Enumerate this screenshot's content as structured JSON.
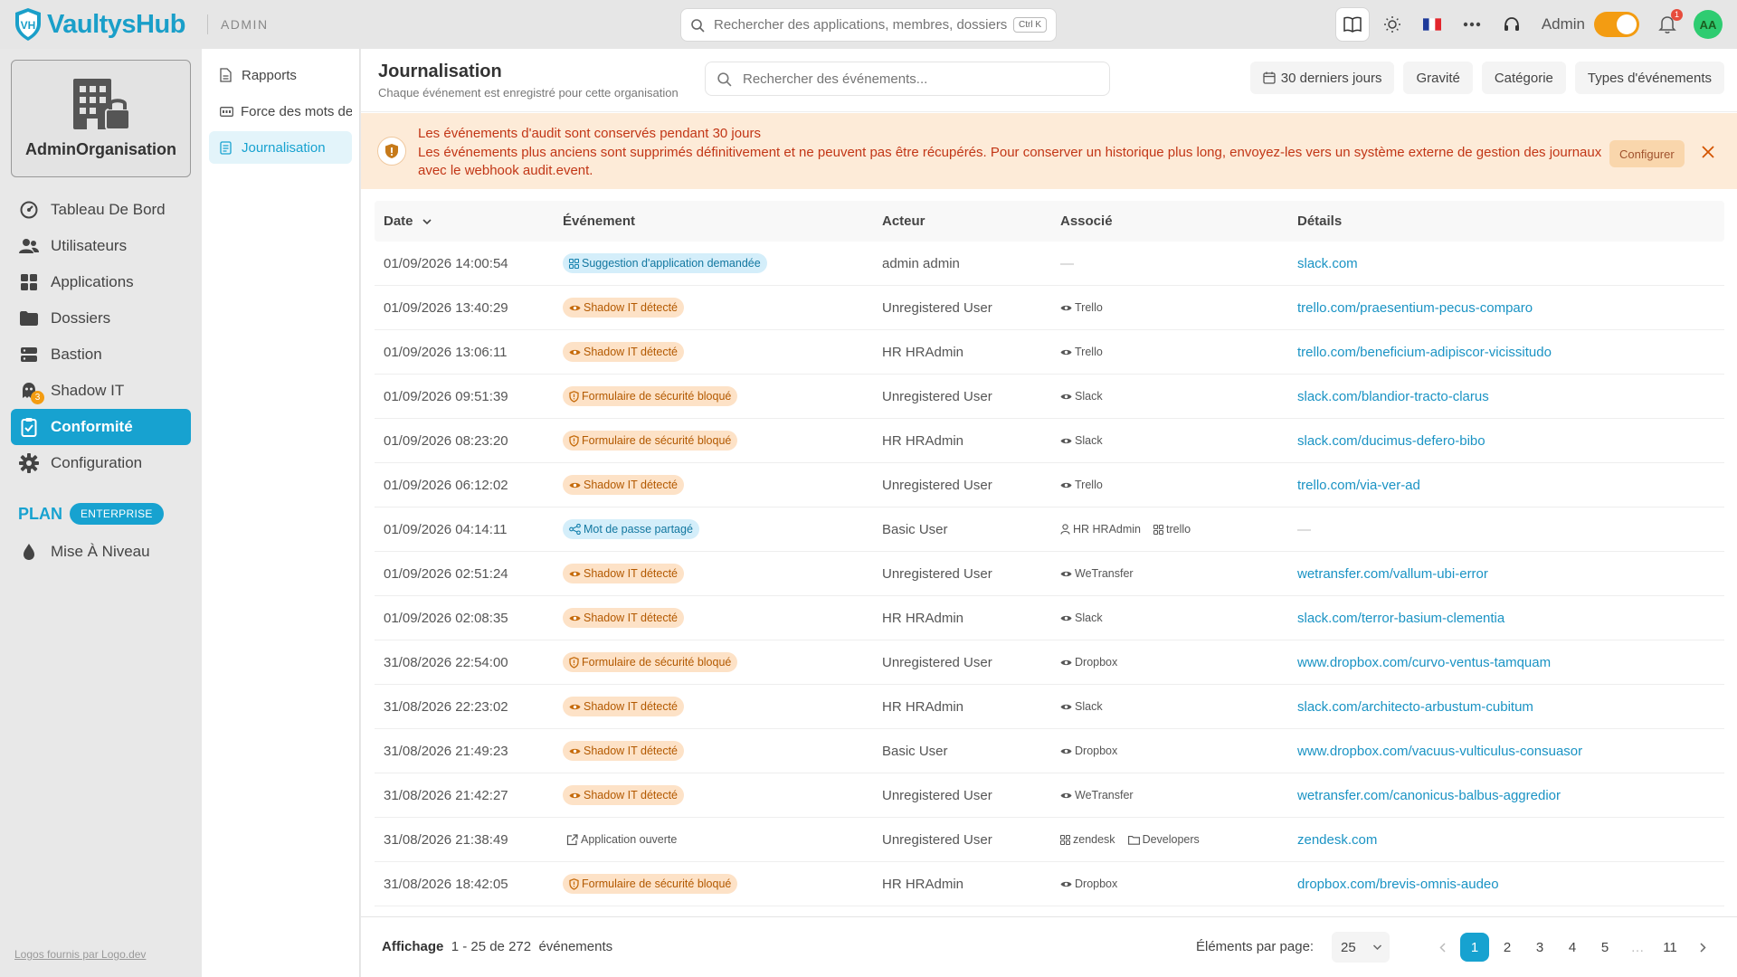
{
  "app": {
    "name": "VaultysHub",
    "context": "ADMIN"
  },
  "global_search": {
    "placeholder": "Rechercher des applications, membres, dossiers",
    "shortcut": "Ctrl K"
  },
  "topbar": {
    "user_role": "Admin",
    "notification_count": "1",
    "avatar_initials": "AA"
  },
  "org": {
    "name": "AdminOrganisation"
  },
  "nav": [
    {
      "label": "Tableau De Bord",
      "icon": "dashboard-icon"
    },
    {
      "label": "Utilisateurs",
      "icon": "users-icon"
    },
    {
      "label": "Applications",
      "icon": "apps-grid-icon"
    },
    {
      "label": "Dossiers",
      "icon": "folder-icon"
    },
    {
      "label": "Bastion",
      "icon": "server-icon"
    },
    {
      "label": "Shadow IT",
      "icon": "ghost-icon",
      "badge": "3"
    },
    {
      "label": "Conformité",
      "icon": "clipboard-icon",
      "active": true
    },
    {
      "label": "Configuration",
      "icon": "gear-icon"
    }
  ],
  "plan": {
    "label": "PLAN",
    "tier": "ENTERPRISE",
    "upgrade_label": "Mise À Niveau"
  },
  "logo_credit": "Logos fournis par Logo.dev",
  "subnav": [
    {
      "label": "Rapports"
    },
    {
      "label": "Force des mots de passe"
    },
    {
      "label": "Journalisation",
      "active": true
    }
  ],
  "page": {
    "title": "Journalisation",
    "subtitle": "Chaque événement est enregistré pour cette organisation",
    "search_placeholder": "Rechercher des événements...",
    "filters": {
      "period": "30 derniers jours",
      "severity": "Gravité",
      "category": "Catégorie",
      "types": "Types d'événements"
    }
  },
  "alert": {
    "title": "Les événements d'audit sont conservés pendant 30 jours",
    "text": "Les événements plus anciens sont supprimés définitivement et ne peuvent pas être récupérés. Pour conserver un historique plus long, envoyez-les vers un système externe de gestion des journaux avec le webhook audit.event.",
    "button": "Configurer"
  },
  "table": {
    "headers": {
      "date": "Date",
      "event": "Événement",
      "actor": "Acteur",
      "associated": "Associé",
      "details": "Détails"
    },
    "rows": [
      {
        "date": "01/09/2026 14:00:54",
        "event": "Suggestion d'application demandée",
        "event_style": "blue",
        "event_icon": "apps",
        "actor": "admin admin",
        "assoc": [],
        "details": "slack.com"
      },
      {
        "date": "01/09/2026 13:40:29",
        "event": "Shadow IT détecté",
        "event_style": "orange",
        "event_icon": "eye",
        "actor": "Unregistered User",
        "assoc": [
          {
            "icon": "eye",
            "label": "Trello"
          }
        ],
        "details": "trello.com/praesentium-pecus-comparo"
      },
      {
        "date": "01/09/2026 13:06:11",
        "event": "Shadow IT détecté",
        "event_style": "orange",
        "event_icon": "eye",
        "actor": "HR HRAdmin",
        "assoc": [
          {
            "icon": "eye",
            "label": "Trello"
          }
        ],
        "details": "trello.com/beneficium-adipiscor-vicissitudo"
      },
      {
        "date": "01/09/2026 09:51:39",
        "event": "Formulaire de sécurité bloqué",
        "event_style": "orange",
        "event_icon": "shield",
        "actor": "Unregistered User",
        "assoc": [
          {
            "icon": "eye",
            "label": "Slack"
          }
        ],
        "details": "slack.com/blandior-tracto-clarus"
      },
      {
        "date": "01/09/2026 08:23:20",
        "event": "Formulaire de sécurité bloqué",
        "event_style": "orange",
        "event_icon": "shield",
        "actor": "HR HRAdmin",
        "assoc": [
          {
            "icon": "eye",
            "label": "Slack"
          }
        ],
        "details": "slack.com/ducimus-defero-bibo"
      },
      {
        "date": "01/09/2026 06:12:02",
        "event": "Shadow IT détecté",
        "event_style": "orange",
        "event_icon": "eye",
        "actor": "Unregistered User",
        "assoc": [
          {
            "icon": "eye",
            "label": "Trello"
          }
        ],
        "details": "trello.com/via-ver-ad"
      },
      {
        "date": "01/09/2026 04:14:11",
        "event": "Mot de passe partagé",
        "event_style": "blue",
        "event_icon": "share",
        "actor": "Basic User",
        "assoc": [
          {
            "icon": "user",
            "label": "HR HRAdmin"
          },
          {
            "icon": "apps",
            "label": "trello"
          }
        ],
        "details": ""
      },
      {
        "date": "01/09/2026 02:51:24",
        "event": "Shadow IT détecté",
        "event_style": "orange",
        "event_icon": "eye",
        "actor": "Unregistered User",
        "assoc": [
          {
            "icon": "eye",
            "label": "WeTransfer"
          }
        ],
        "details": "wetransfer.com/vallum-ubi-error"
      },
      {
        "date": "01/09/2026 02:08:35",
        "event": "Shadow IT détecté",
        "event_style": "orange",
        "event_icon": "eye",
        "actor": "HR HRAdmin",
        "assoc": [
          {
            "icon": "eye",
            "label": "Slack"
          }
        ],
        "details": "slack.com/terror-basium-clementia"
      },
      {
        "date": "31/08/2026 22:54:00",
        "event": "Formulaire de sécurité bloqué",
        "event_style": "orange",
        "event_icon": "shield",
        "actor": "Unregistered User",
        "assoc": [
          {
            "icon": "eye",
            "label": "Dropbox"
          }
        ],
        "details": "www.dropbox.com/curvo-ventus-tamquam"
      },
      {
        "date": "31/08/2026 22:23:02",
        "event": "Shadow IT détecté",
        "event_style": "orange",
        "event_icon": "eye",
        "actor": "HR HRAdmin",
        "assoc": [
          {
            "icon": "eye",
            "label": "Slack"
          }
        ],
        "details": "slack.com/architecto-arbustum-cubitum"
      },
      {
        "date": "31/08/2026 21:49:23",
        "event": "Shadow IT détecté",
        "event_style": "orange",
        "event_icon": "eye",
        "actor": "Basic User",
        "assoc": [
          {
            "icon": "eye",
            "label": "Dropbox"
          }
        ],
        "details": "www.dropbox.com/vacuus-vulticulus-consuasor"
      },
      {
        "date": "31/08/2026 21:42:27",
        "event": "Shadow IT détecté",
        "event_style": "orange",
        "event_icon": "eye",
        "actor": "Unregistered User",
        "assoc": [
          {
            "icon": "eye",
            "label": "WeTransfer"
          }
        ],
        "details": "wetransfer.com/canonicus-balbus-aggredior"
      },
      {
        "date": "31/08/2026 21:38:49",
        "event": "Application ouverte",
        "event_style": "plain",
        "event_icon": "external",
        "actor": "Unregistered User",
        "assoc": [
          {
            "icon": "apps",
            "label": "zendesk"
          },
          {
            "icon": "folder",
            "label": "Developers"
          }
        ],
        "details": "zendesk.com"
      },
      {
        "date": "31/08/2026 18:42:05",
        "event": "Formulaire de sécurité bloqué",
        "event_style": "orange",
        "event_icon": "shield",
        "actor": "HR HRAdmin",
        "assoc": [
          {
            "icon": "eye",
            "label": "Dropbox"
          }
        ],
        "details": "dropbox.com/brevis-omnis-audeo"
      }
    ]
  },
  "footer": {
    "showing_label": "Affichage",
    "range": "1 - 25 de 272",
    "unit": "événements",
    "per_page_label": "Éléments par page:",
    "per_page_value": "25",
    "pages": [
      "1",
      "2",
      "3",
      "4",
      "5",
      "…",
      "11"
    ],
    "current_page": "1"
  }
}
